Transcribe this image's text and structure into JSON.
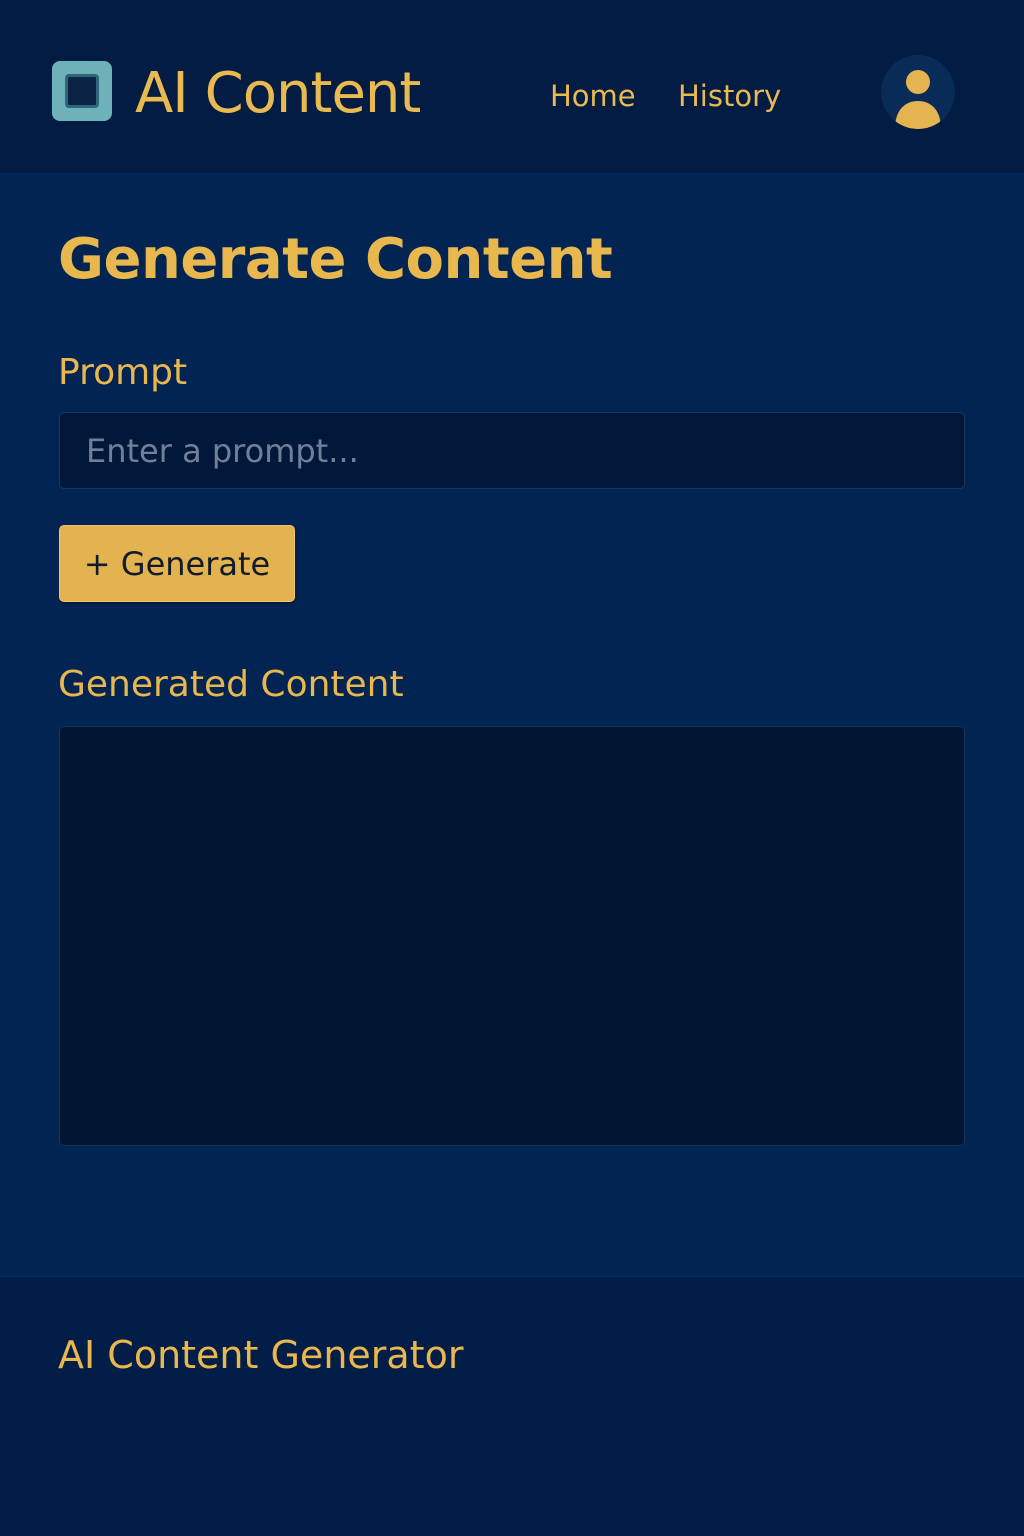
{
  "app": {
    "title": "AI Content"
  },
  "header": {
    "logo_icon": "rounded-square-logo-icon",
    "nav": {
      "home": "Home",
      "history": "History"
    },
    "avatar_icon": "user-avatar-icon"
  },
  "main": {
    "page_title": "Generate Content",
    "prompt": {
      "label": "Prompt",
      "placeholder": "Enter a prompt...",
      "value": ""
    },
    "generate_button": "+ Generate",
    "output": {
      "label": "Generated Content",
      "value": ""
    }
  },
  "footer": {
    "title": "AI Content Generator"
  },
  "colors": {
    "background": "#022453",
    "header": "#021c44",
    "accent": "#e8b84e",
    "input_background": "#01183b",
    "logo_teal": "#6fb1b9"
  }
}
